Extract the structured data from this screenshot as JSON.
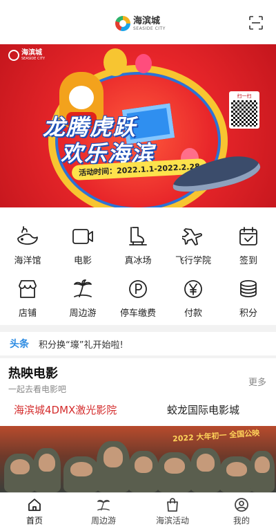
{
  "header": {
    "logo_cn": "海滨城",
    "logo_en": "SEASIDE CITY",
    "scan_icon": "scan-icon"
  },
  "banner": {
    "logo_cn": "海滨城",
    "logo_en": "SEASIDE CITY",
    "qr_title": "扫一扫",
    "slogan_line1": "龙腾虎跃",
    "slogan_line2": "欢乐海滨",
    "date_label": "活动时间：",
    "date_range": "2022.1.1-2022.2.28"
  },
  "grid": {
    "items": [
      {
        "label": "海洋馆",
        "icon": "whale-icon"
      },
      {
        "label": "电影",
        "icon": "video-camera-icon"
      },
      {
        "label": "真冰场",
        "icon": "ice-skate-icon"
      },
      {
        "label": "飞行学院",
        "icon": "airplane-icon"
      },
      {
        "label": "签到",
        "icon": "calendar-check-icon"
      },
      {
        "label": "店铺",
        "icon": "storefront-icon"
      },
      {
        "label": "周边游",
        "icon": "palm-tree-icon"
      },
      {
        "label": "停车缴费",
        "icon": "parking-icon"
      },
      {
        "label": "付款",
        "icon": "yen-icon"
      },
      {
        "label": "积分",
        "icon": "coin-stack-icon"
      }
    ]
  },
  "ticker": {
    "tag": "头条",
    "text": "积分换“壕”礼开始啦!"
  },
  "now_showing": {
    "title": "热映电影",
    "subtitle": "一起去看电影吧",
    "more": "更多",
    "cinemas": [
      {
        "label": "海滨城4DMX激光影院",
        "active": true
      },
      {
        "label": "蛟龙国际电影城",
        "active": false
      }
    ],
    "poster_caption": "2022 大年初一 全国公映"
  },
  "tabbar": {
    "items": [
      {
        "label": "首页",
        "icon": "home-icon",
        "active": true
      },
      {
        "label": "周边游",
        "icon": "palm-tree-icon",
        "active": false
      },
      {
        "label": "海滨活动",
        "icon": "shopping-bag-icon",
        "active": false
      },
      {
        "label": "我的",
        "icon": "user-icon",
        "active": false
      }
    ]
  },
  "colors": {
    "accent_blue": "#2a8ae2",
    "active_red": "#d42c2c",
    "banner_red": "#e8262a"
  }
}
